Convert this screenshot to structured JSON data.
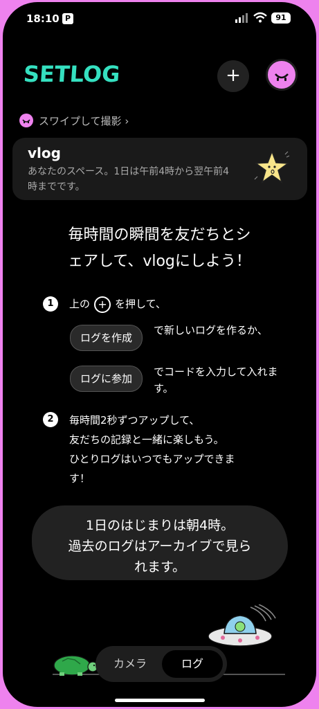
{
  "status_bar": {
    "time": "18:10",
    "app_badge": "P",
    "battery": "91"
  },
  "header": {
    "logo": "SETLOG",
    "add_label": "+"
  },
  "swipe_hint": {
    "label": "スワイプして撮影 ›"
  },
  "space_card": {
    "title": "vlog",
    "description": "あなたのスペース。1日は午前4時から翌午前4時までです。"
  },
  "headline": {
    "line1": "毎時間の瞬間を友だちとシ",
    "line2": "ェアして、vlogにしよう！"
  },
  "steps": [
    {
      "number": "1",
      "prefix": "上の",
      "plus": "+",
      "suffix": "を押して、",
      "buttons": [
        {
          "label": "ログを作成",
          "desc": "で新しいログを作るか、"
        },
        {
          "label": "ログに参加",
          "desc": "でコードを入力して入れます。"
        }
      ]
    },
    {
      "number": "2",
      "lines": [
        "毎時間2秒ずつアップして、",
        "友だちの記録と一緒に楽しもう。",
        "ひとりログはいつでもアップできま",
        "す！"
      ]
    }
  ],
  "bubble": {
    "lines": [
      "1日のはじまりは朝4時。",
      "過去のログはアーカイブで見ら",
      "れます。"
    ]
  },
  "tabs": [
    {
      "label": "カメラ"
    },
    {
      "label": "ログ",
      "active": true
    }
  ],
  "colors": {
    "accent_pink": "#ee82ee",
    "logo_teal": "#35e0c0",
    "background": "#000000",
    "card": "#1a1a1a"
  }
}
